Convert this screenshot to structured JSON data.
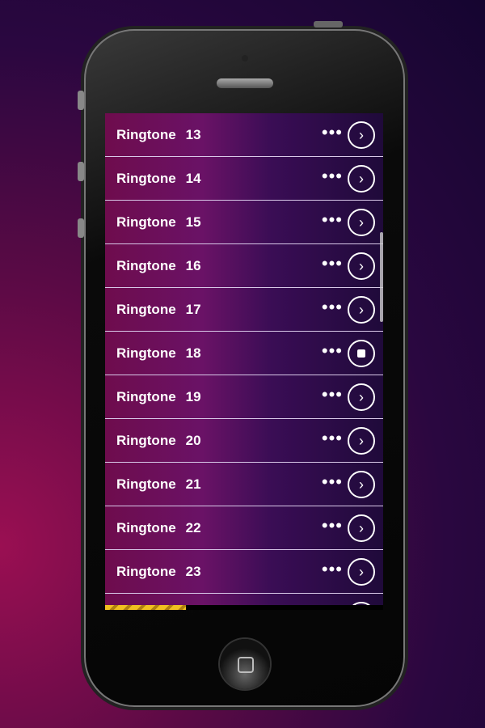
{
  "items": [
    {
      "label": "Ringtone",
      "number": "13",
      "state": "play"
    },
    {
      "label": "Ringtone",
      "number": "14",
      "state": "play"
    },
    {
      "label": "Ringtone",
      "number": "15",
      "state": "play"
    },
    {
      "label": "Ringtone",
      "number": "16",
      "state": "play"
    },
    {
      "label": "Ringtone",
      "number": "17",
      "state": "play"
    },
    {
      "label": "Ringtone",
      "number": "18",
      "state": "stop"
    },
    {
      "label": "Ringtone",
      "number": "19",
      "state": "play"
    },
    {
      "label": "Ringtone",
      "number": "20",
      "state": "play"
    },
    {
      "label": "Ringtone",
      "number": "21",
      "state": "play"
    },
    {
      "label": "Ringtone",
      "number": "22",
      "state": "play"
    },
    {
      "label": "Ringtone",
      "number": "23",
      "state": "play"
    },
    {
      "label": "",
      "number": "",
      "state": "play"
    }
  ],
  "more_icon": "ellipsis-icon",
  "playback_progress_percent": 29,
  "colors": {
    "progress": "#f0c020"
  }
}
